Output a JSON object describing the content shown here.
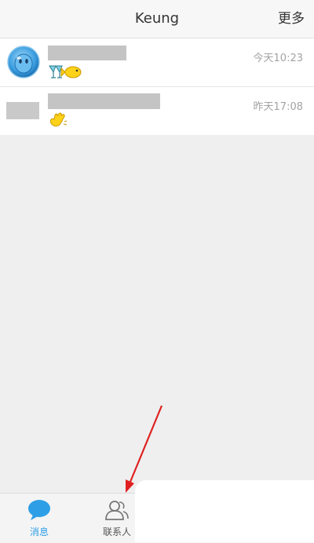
{
  "header": {
    "title": "Keung",
    "more_label": "更多"
  },
  "conversations": [
    {
      "name_hidden": true,
      "message_icon": "toast-and-fish-emoji",
      "time": "今天10:23"
    },
    {
      "name_hidden": true,
      "message_icon": "waving-hand-emoji",
      "time": "昨天17:08"
    }
  ],
  "tabbar": {
    "messages_label": "消息",
    "contacts_label": "联系人",
    "active_color": "#2e9fe6"
  },
  "annotation": {
    "arrow_color": "#e02020"
  }
}
